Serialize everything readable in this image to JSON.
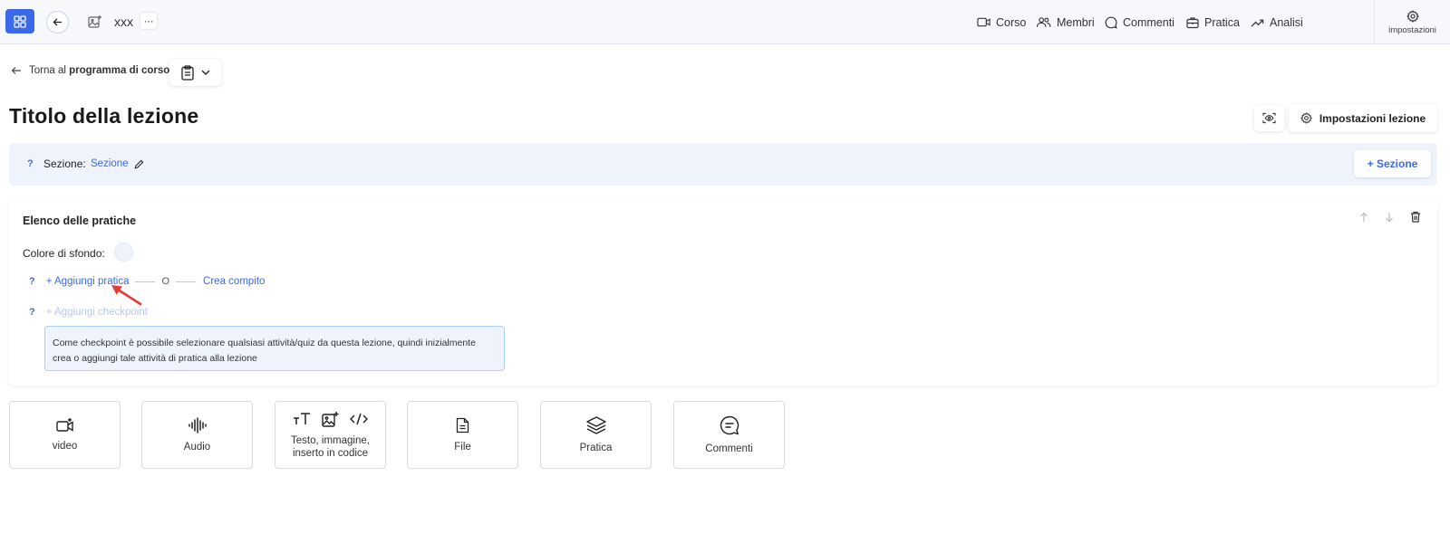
{
  "topbar": {
    "course_name": "xxx",
    "more_label": "···",
    "nav": [
      {
        "label": "Corso",
        "icon": "video-icon"
      },
      {
        "label": "Membri",
        "icon": "users-icon"
      },
      {
        "label": "Commenti",
        "icon": "comment-icon"
      },
      {
        "label": "Pratica",
        "icon": "briefcase-icon"
      },
      {
        "label": "Analisi",
        "icon": "trend-up-icon"
      }
    ],
    "settings_label": "impostazioni"
  },
  "breadcrumb": {
    "prefix": "Torna al",
    "link": "programma di corso"
  },
  "lesson": {
    "title": "Titolo della lezione",
    "settings_button": "Impostazioni lezione"
  },
  "section": {
    "help": "?",
    "label": "Sezione:",
    "value": "Sezione",
    "add_button": "+ Sezione"
  },
  "practices": {
    "title": "Elenco delle pratiche",
    "bg_label": "Colore di sfondo:",
    "bg_color": "#eef3fc",
    "help": "?",
    "add_practice": "+ Aggiungi pratica",
    "or": "O",
    "create_task": "Crea compito",
    "add_checkpoint": "+ Aggiungi checkpoint",
    "info": "Come checkpoint è possibile selezionare qualsiasi attività/quiz da questa lezione, quindi inizialmente crea o aggiungi tale attività di pratica alla lezione"
  },
  "tools": [
    {
      "label": "video"
    },
    {
      "label": "Audio"
    },
    {
      "label": "Testo, immagine, inserto in codice"
    },
    {
      "label": "File"
    },
    {
      "label": "Pratica"
    },
    {
      "label": "Commenti"
    }
  ],
  "colors": {
    "accent": "#3b6ae8",
    "annotation": "#e53935"
  }
}
